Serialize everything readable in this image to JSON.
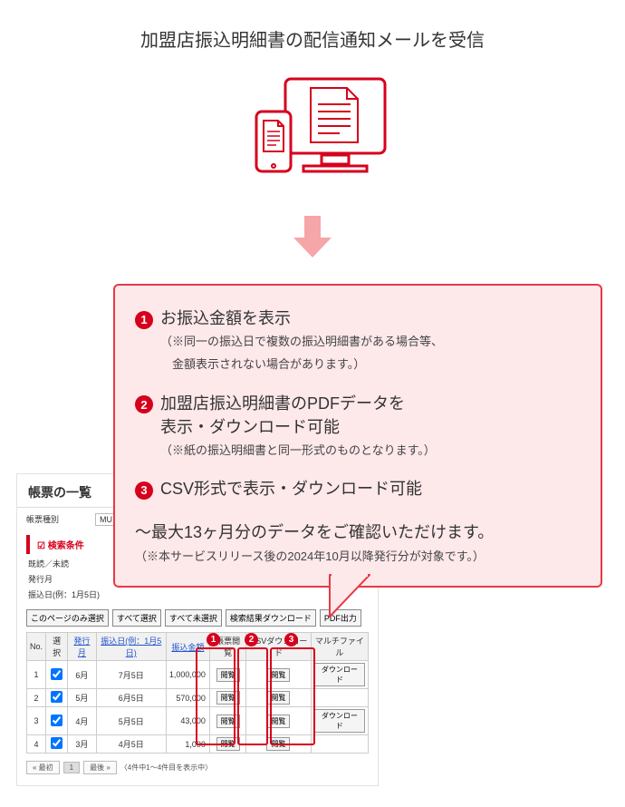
{
  "title": "加盟店振込明細書の配信通知メールを受信",
  "callout": {
    "features": [
      {
        "num": "1",
        "head": "お振込金額を表示",
        "note1": "（※同一の振込日で複数の振込明細書がある場合等、",
        "note2": "　金額表示されない場合があります。）"
      },
      {
        "num": "2",
        "head": "加盟店振込明細書のPDFデータを",
        "head2": "表示・ダウンロード可能",
        "note1": "（※紙の振込明細書と同一形式のものとなります。）"
      },
      {
        "num": "3",
        "head": "CSV形式で表示・ダウンロード可能"
      }
    ],
    "summary": "～最大13ヶ月分のデータをご確認いただけます。",
    "summary_note": "（※本サービスリリース後の2024年10月以降発行分が対象です。）"
  },
  "panel": {
    "title": "帳票の一覧",
    "type_label": "帳票種別",
    "type_value": "MU",
    "search_head": "検索条件",
    "cond_read": "既読／未読",
    "cond_month": "発行月",
    "cond_date": "振込日(例：1月5日)",
    "btns": {
      "page_only": "このページのみ選択",
      "all": "すべて選択",
      "none": "すべて未選択",
      "dl_result": "検索結果ダウンロード",
      "pdf": "PDF出力"
    },
    "headers": {
      "no": "No.",
      "sel": "選択",
      "month": "発行月",
      "date": "振込日(例：1月5日)",
      "amount": "振込金額",
      "view": "帳票閲覧",
      "csv": "CSVダウンロード",
      "multi": "マルチファイル"
    },
    "rows": [
      {
        "no": "1",
        "month": "6月",
        "date": "7月5日",
        "amount": "1,000,000",
        "view": "閲覧",
        "csv": "閲覧",
        "multi": "ダウンロード"
      },
      {
        "no": "2",
        "month": "5月",
        "date": "6月5日",
        "amount": "570,000",
        "view": "閲覧",
        "csv": "閲覧",
        "multi": ""
      },
      {
        "no": "3",
        "month": "4月",
        "date": "5月5日",
        "amount": "43,000",
        "view": "閲覧",
        "csv": "閲覧",
        "multi": "ダウンロード"
      },
      {
        "no": "4",
        "month": "3月",
        "date": "4月5日",
        "amount": "1,000",
        "view": "閲覧",
        "csv": "閲覧",
        "multi": ""
      }
    ],
    "pager": {
      "first": "« 最初",
      "page1": "1",
      "last": "最後 »",
      "info": "〈4件中1～4件目を表示中〉"
    }
  },
  "overlay_nums": {
    "one": "1",
    "two": "2",
    "three": "3"
  }
}
